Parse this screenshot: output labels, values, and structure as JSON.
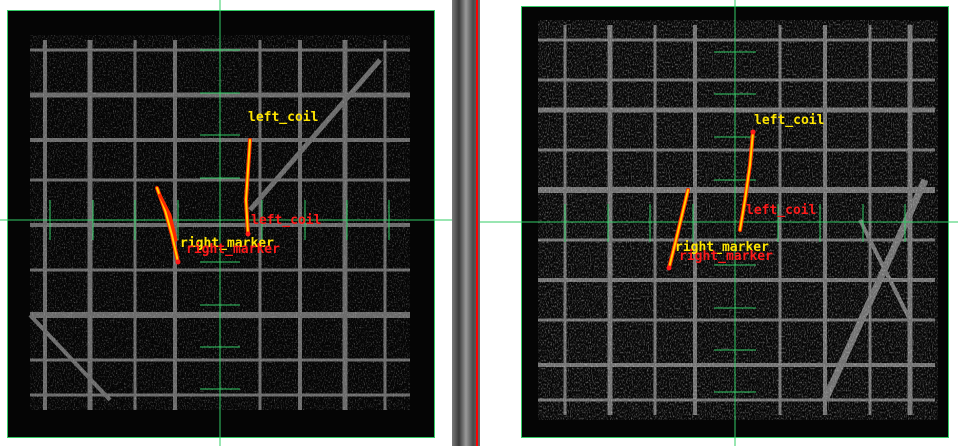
{
  "colors": {
    "crosshair": "#33cc66",
    "trace_outer": "#ff2a00",
    "trace_inner": "#ffd000",
    "label_primary": "#ffe600",
    "label_secondary": "#ff1a1a",
    "divider_accent": "#ff0000"
  },
  "left_view": {
    "annotations": {
      "coil_label": "left_coil",
      "coil_label_ghost": "left_coil",
      "marker_label": "right_marker",
      "marker_label_ghost": "right_marker"
    }
  },
  "right_view": {
    "annotations": {
      "coil_label": "left_coil",
      "coil_label_ghost": "left_coil",
      "marker_label": "right_marker",
      "marker_label_ghost": "right_marker"
    }
  }
}
